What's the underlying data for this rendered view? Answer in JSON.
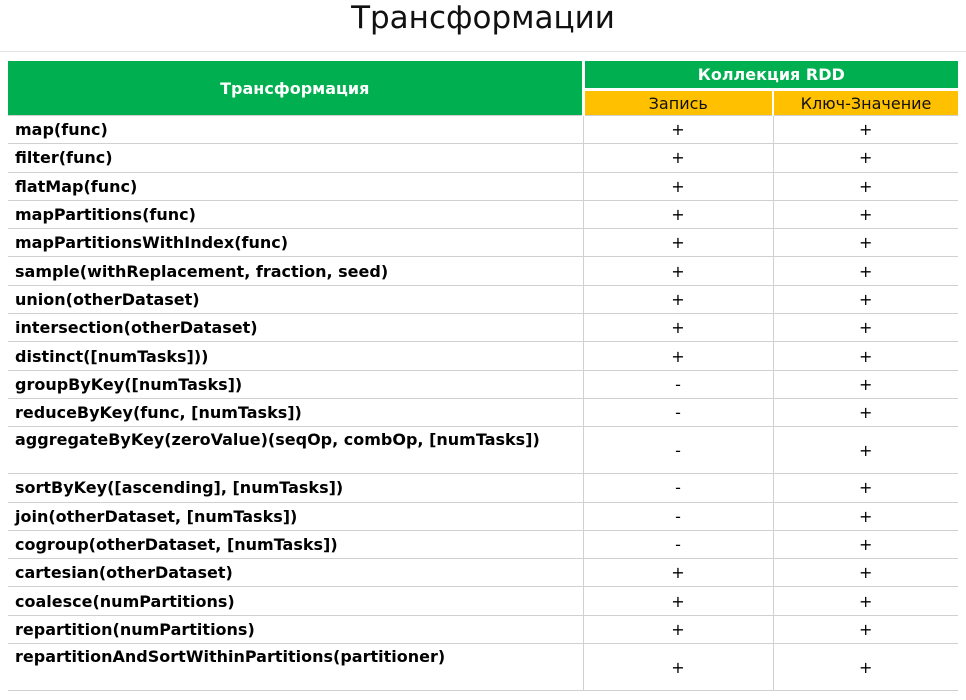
{
  "page": {
    "title": "Трансформации"
  },
  "table": {
    "header_transform": "Трансформация",
    "header_collection": "Коллекция RDD",
    "header_record": "Запись",
    "header_key_value": "Ключ-Значение",
    "colors": {
      "green_header": "#00b050",
      "orange_header": "#ffc000"
    },
    "rows": [
      {
        "name": "map(func)",
        "record": "+",
        "key_value": "+"
      },
      {
        "name": "filter(func)",
        "record": "+",
        "key_value": "+"
      },
      {
        "name": "flatMap(func)",
        "record": "+",
        "key_value": "+"
      },
      {
        "name": "mapPartitions(func)",
        "record": "+",
        "key_value": "+"
      },
      {
        "name": "mapPartitionsWithIndex(func)",
        "record": "+",
        "key_value": "+"
      },
      {
        "name": "sample(withReplacement, fraction, seed)",
        "record": "+",
        "key_value": "+"
      },
      {
        "name": "union(otherDataset)",
        "record": "+",
        "key_value": "+"
      },
      {
        "name": "intersection(otherDataset)",
        "record": "+",
        "key_value": "+"
      },
      {
        "name": "distinct([numTasks]))",
        "record": "+",
        "key_value": "+"
      },
      {
        "name": "groupByKey([numTasks])",
        "record": "-",
        "key_value": "+"
      },
      {
        "name": "reduceByKey(func, [numTasks])",
        "record": "-",
        "key_value": "+"
      },
      {
        "name": "aggregateByKey(zeroValue)(seqOp, combOp, [numTasks])",
        "record": "-",
        "key_value": "+"
      },
      {
        "name": "sortByKey([ascending], [numTasks])",
        "record": "-",
        "key_value": "+"
      },
      {
        "name": "join(otherDataset, [numTasks])",
        "record": "-",
        "key_value": "+"
      },
      {
        "name": "cogroup(otherDataset, [numTasks])",
        "record": "-",
        "key_value": "+"
      },
      {
        "name": "cartesian(otherDataset)",
        "record": "+",
        "key_value": "+"
      },
      {
        "name": "coalesce(numPartitions)",
        "record": "+",
        "key_value": "+"
      },
      {
        "name": "repartition(numPartitions)",
        "record": "+",
        "key_value": "+"
      },
      {
        "name": "repartitionAndSortWithinPartitions(partitioner)",
        "record": "+",
        "key_value": "+"
      }
    ]
  }
}
